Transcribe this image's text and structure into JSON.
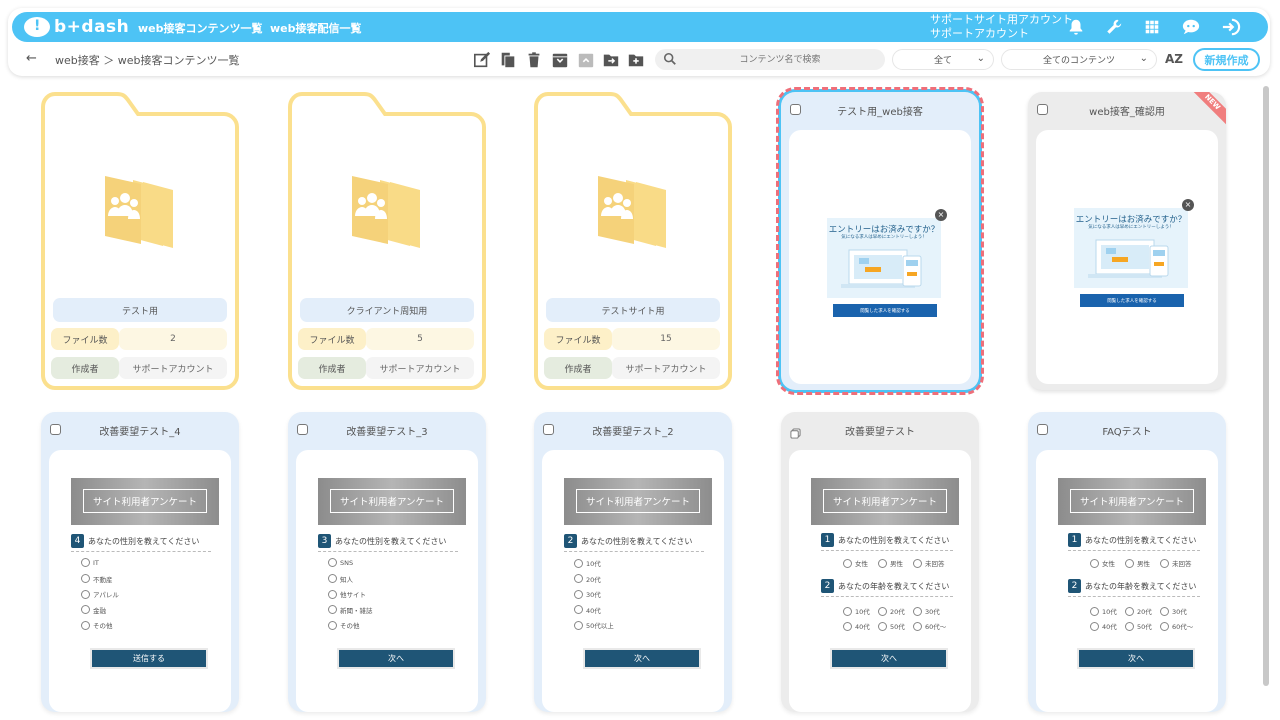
{
  "header": {
    "logo_text": "b+dash",
    "nav": [
      "web接客コンテンツ一覧",
      "web接客配信一覧"
    ],
    "account_line1": "サポートサイト用アカウント",
    "account_line2": "サポートアカウント",
    "icons": [
      "bell-icon",
      "wrench-icon",
      "grid-icon",
      "chat-icon",
      "logout-icon"
    ]
  },
  "subbar": {
    "back": "←",
    "breadcrumb": "web接客 ＞ web接客コンテンツ一覧",
    "tools": [
      "edit-icon",
      "copy-icon",
      "trash-icon",
      "archive-icon",
      "unarchive-icon",
      "move-icon",
      "add-folder-icon"
    ],
    "search_placeholder": "コンテンツ名で検索",
    "filter1": "全て",
    "filter2": "全てのコンテンツ",
    "sort": "AZ",
    "new_button": "新規作成"
  },
  "folders": [
    {
      "name": "テスト用",
      "files_label": "ファイル数",
      "files": "2",
      "owner_label": "作成者",
      "owner": "サポートアカウント"
    },
    {
      "name": "クライアント周知用",
      "files_label": "ファイル数",
      "files": "5",
      "owner_label": "作成者",
      "owner": "サポートアカウント"
    },
    {
      "name": "テストサイト用",
      "files_label": "ファイル数",
      "files": "15",
      "owner_label": "作成者",
      "owner": "サポートアカウント"
    }
  ],
  "popup_cards": [
    {
      "title": "テスト用_web接客",
      "popup_title": "エントリーはお済みですか？",
      "popup_sub": "気になる求人は早めにエントリーしよう！",
      "popup_button": "閲覧した求人を確認する",
      "badge": ""
    },
    {
      "title": "web接客_確認用",
      "popup_title": "エントリーはお済みですか？",
      "popup_sub": "気になる求人は早めにエントリーしよう！",
      "popup_button": "閲覧した求人を確認する",
      "badge": "NEW"
    }
  ],
  "survey_cards": [
    {
      "title": "改善要望テスト_4",
      "banner": "サイト利用者アンケート",
      "button": "送信する",
      "questions": [
        {
          "num": "4",
          "text": "あなたの性別を教えてください",
          "options": [
            "IT",
            "不動産",
            "アパレル",
            "金融",
            "その他"
          ]
        }
      ]
    },
    {
      "title": "改善要望テスト_3",
      "banner": "サイト利用者アンケート",
      "button": "次へ",
      "questions": [
        {
          "num": "3",
          "text": "あなたの性別を教えてください",
          "options": [
            "SNS",
            "知人",
            "他サイト",
            "新聞・雑誌",
            "その他"
          ]
        }
      ]
    },
    {
      "title": "改善要望テスト_2",
      "banner": "サイト利用者アンケート",
      "button": "次へ",
      "questions": [
        {
          "num": "2",
          "text": "あなたの性別を教えてください",
          "options": [
            "10代",
            "20代",
            "30代",
            "40代",
            "50代以上"
          ]
        }
      ]
    },
    {
      "title": "改善要望テスト",
      "banner": "サイト利用者アンケート",
      "button": "次へ",
      "questions": [
        {
          "num": "1",
          "text": "あなたの性別を教えてください",
          "options": [
            "女性",
            "男性",
            "未回答"
          ]
        },
        {
          "num": "2",
          "text": "あなたの年齢を教えてください",
          "options": [
            "10代",
            "20代",
            "30代",
            "40代",
            "50代",
            "60代〜"
          ]
        }
      ]
    },
    {
      "title": "FAQテスト",
      "banner": "サイト利用者アンケート",
      "button": "次へ",
      "questions": [
        {
          "num": "1",
          "text": "あなたの性別を教えてください",
          "options": [
            "女性",
            "男性",
            "未回答"
          ]
        },
        {
          "num": "2",
          "text": "あなたの年齢を教えてください",
          "options": [
            "10代",
            "20代",
            "30代",
            "40代",
            "50代",
            "60代〜"
          ]
        }
      ]
    }
  ],
  "colors": {
    "accent": "#4dc3f5",
    "folder": "#fbe08e",
    "navy": "#1f5576",
    "selected_dash": "#ee6f7a"
  }
}
